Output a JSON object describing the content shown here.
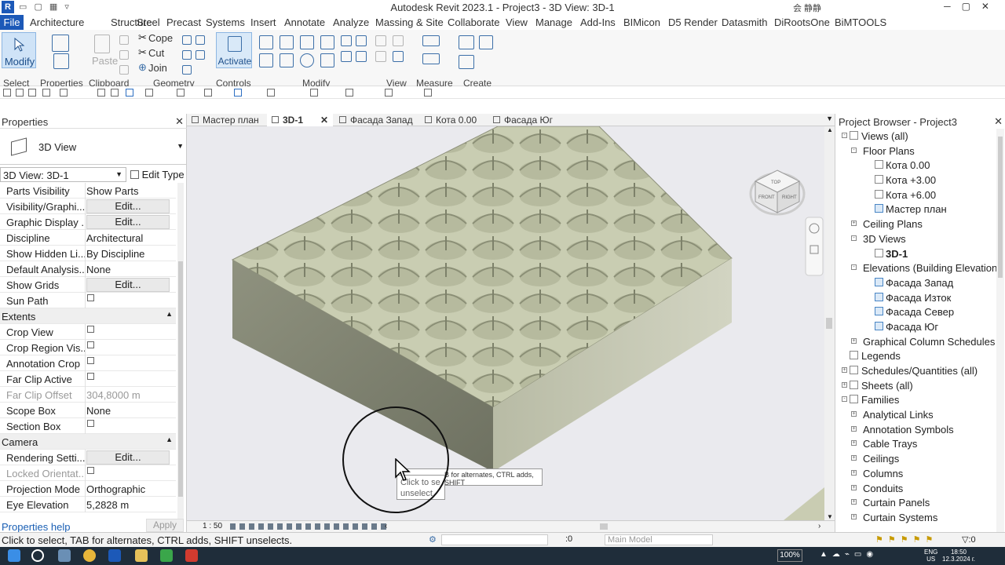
{
  "window": {
    "title": "Autodesk Revit 2023.1 - Project3 - 3D View: 3D-1",
    "user": "会 静静",
    "logo_text": "R"
  },
  "menu": [
    "File",
    "Architecture",
    "Structure",
    "Steel",
    "Precast",
    "Systems",
    "Insert",
    "Annotate",
    "Analyze",
    "Massing & Site",
    "Collaborate",
    "View",
    "Manage",
    "Add-Ins",
    "BIMicon",
    "D5 Render",
    "Datasmith",
    "DiRootsOne",
    "BiMTOOLS"
  ],
  "ribbon": {
    "modify": "Modify",
    "paste": "Paste",
    "cope": "Cope",
    "cut": "Cut",
    "join": "Join",
    "activate": "Activate",
    "panels": [
      "Select",
      "Properties",
      "Clipboard",
      "Geometry",
      "Controls",
      "Modify",
      "View",
      "Measure",
      "Create"
    ]
  },
  "properties": {
    "title": "Properties",
    "type_name": "3D View",
    "instance": "3D View: 3D-1",
    "edit_type": "Edit Type",
    "rows": [
      {
        "k": "Parts Visibility",
        "v": "Show Parts"
      },
      {
        "k": "Visibility/Graphi...",
        "btn": "Edit..."
      },
      {
        "k": "Graphic Display ...",
        "btn": "Edit..."
      },
      {
        "k": "Discipline",
        "v": "Architectural"
      },
      {
        "k": "Show Hidden Li...",
        "v": "By Discipline"
      },
      {
        "k": "Default Analysis...",
        "v": "None"
      },
      {
        "k": "Show Grids",
        "btn": "Edit..."
      },
      {
        "k": "Sun Path",
        "cb": true
      },
      {
        "cat": "Extents"
      },
      {
        "k": "Crop View",
        "cb": true
      },
      {
        "k": "Crop Region Vis...",
        "cb": true
      },
      {
        "k": "Annotation Crop",
        "cb": true
      },
      {
        "k": "Far Clip Active",
        "cb": true
      },
      {
        "k": "Far Clip Offset",
        "v": "304,8000 m",
        "dim": true
      },
      {
        "k": "Scope Box",
        "v": "None"
      },
      {
        "k": "Section Box",
        "cb": true
      },
      {
        "cat": "Camera"
      },
      {
        "k": "Rendering Setti...",
        "btn": "Edit..."
      },
      {
        "k": "Locked Orientat...",
        "cb": true,
        "dim": true
      },
      {
        "k": "Projection Mode",
        "v": "Orthographic"
      },
      {
        "k": "Eye Elevation",
        "v": "5,2828 m"
      }
    ],
    "help": "Properties help",
    "apply": "Apply"
  },
  "tabs": [
    {
      "label": "Мастер план",
      "active": false
    },
    {
      "label": "3D-1",
      "active": true
    },
    {
      "label": "Фасада Запад",
      "active": false
    },
    {
      "label": "Кота 0.00",
      "active": false
    },
    {
      "label": "Фасада Юг",
      "active": false
    }
  ],
  "view": {
    "scale": "1 : 50",
    "cube_top": "TOP",
    "cube_front": "FRONT",
    "cube_right": "RIGHT",
    "tooltip": "B for alternates, CTRL adds, SHIFT",
    "tooltip2_line1": "Click to se",
    "tooltip2_line2": "unselect"
  },
  "browser": {
    "title": "Project Browser - Project3",
    "nodes": [
      {
        "lvl": 0,
        "exp": "-",
        "label": "Views (all)",
        "icon": "views-icon"
      },
      {
        "lvl": 1,
        "exp": "-",
        "label": "Floor Plans"
      },
      {
        "lvl": 2,
        "label": "Кота 0.00",
        "icon": "plain"
      },
      {
        "lvl": 2,
        "label": "Кота +3.00",
        "icon": "plain"
      },
      {
        "lvl": 2,
        "label": "Кота +6.00",
        "icon": "plain"
      },
      {
        "lvl": 2,
        "label": "Мастер план",
        "icon": "view"
      },
      {
        "lvl": 1,
        "exp": "+",
        "label": "Ceiling Plans"
      },
      {
        "lvl": 1,
        "exp": "-",
        "label": "3D Views"
      },
      {
        "lvl": 2,
        "label": "3D-1",
        "icon": "plain",
        "bold": true
      },
      {
        "lvl": 1,
        "exp": "-",
        "label": "Elevations (Building Elevation)"
      },
      {
        "lvl": 2,
        "label": "Фасада Запад",
        "icon": "view"
      },
      {
        "lvl": 2,
        "label": "Фасада Изток",
        "icon": "view"
      },
      {
        "lvl": 2,
        "label": "Фасада Север",
        "icon": "view"
      },
      {
        "lvl": 2,
        "label": "Фасада Юг",
        "icon": "view"
      },
      {
        "lvl": 1,
        "exp": "+",
        "label": "Graphical Column Schedules"
      },
      {
        "lvl": 0,
        "label": "Legends",
        "icon": "list"
      },
      {
        "lvl": 0,
        "exp": "+",
        "label": "Schedules/Quantities (all)",
        "icon": "list"
      },
      {
        "lvl": 0,
        "exp": "+",
        "label": "Sheets (all)",
        "icon": "list"
      },
      {
        "lvl": 0,
        "exp": "-",
        "label": "Families",
        "icon": "list"
      },
      {
        "lvl": 1,
        "exp": "+",
        "label": "Analytical Links"
      },
      {
        "lvl": 1,
        "exp": "+",
        "label": "Annotation Symbols"
      },
      {
        "lvl": 1,
        "exp": "+",
        "label": "Cable Trays"
      },
      {
        "lvl": 1,
        "exp": "+",
        "label": "Ceilings"
      },
      {
        "lvl": 1,
        "exp": "+",
        "label": "Columns"
      },
      {
        "lvl": 1,
        "exp": "+",
        "label": "Conduits"
      },
      {
        "lvl": 1,
        "exp": "+",
        "label": "Curtain Panels"
      },
      {
        "lvl": 1,
        "exp": "+",
        "label": "Curtain Systems"
      }
    ]
  },
  "status": {
    "message": "Click to select, TAB for alternates, CTRL adds, SHIFT unselects.",
    "zero": ":0",
    "model": "Main Model",
    "filter": ":0"
  },
  "taskbar": {
    "zoom": "100%",
    "lang1": "ENG",
    "lang2": "US",
    "time": "18:50",
    "date": "12.3.2024 г."
  }
}
